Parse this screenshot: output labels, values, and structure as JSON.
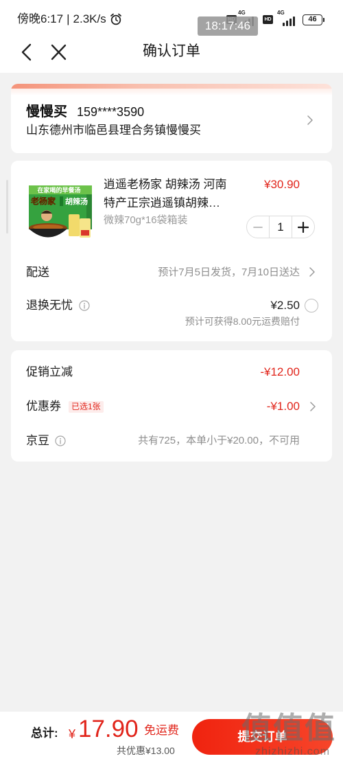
{
  "status_bar": {
    "time": "傍晚6:17",
    "separator": "|",
    "net_speed": "2.3K/s",
    "sim1_hd": "HD",
    "sim1_net": "4G",
    "sim2_hd": "HD",
    "sim2_net": "4G",
    "battery": "46",
    "icons": [
      "alarm-icon",
      "signal-icon",
      "battery-icon"
    ]
  },
  "recording_time": "18:17:46",
  "header": {
    "title": "确认订单",
    "icons": [
      "back-icon",
      "close-icon"
    ]
  },
  "address": {
    "name": "慢慢买",
    "phone": "159****3590",
    "detail": "山东德州市临邑县理合务镇慢慢买",
    "icon": "chevron-right-icon"
  },
  "product": {
    "title_lines": [
      "逍遥老杨家 胡辣汤 河南",
      "特产正宗逍遥镇胡辣…"
    ],
    "price": "¥30.90",
    "spec": "微辣70g*16袋箱装",
    "quantity": "1",
    "stepper_icons": [
      "minus-icon",
      "plus-icon"
    ],
    "image_text": {
      "banner": "在家喝的早餐汤",
      "brand": "老杨家",
      "name": "胡辣汤"
    }
  },
  "delivery": {
    "label": "配送",
    "value": "预计7月5日发货，7月10日送达"
  },
  "return_insurance": {
    "label": "退换无忧",
    "price": "¥2.50",
    "note": "预计可获得8.00元运费赔付",
    "selected": false
  },
  "discounts": {
    "promotion": {
      "label": "促销立减",
      "value": "-¥12.00"
    },
    "coupon": {
      "label": "优惠券",
      "badge": "已选1张",
      "value": "-¥1.00"
    },
    "jingdou": {
      "label": "京豆",
      "value": "共有725，本单小于¥20.00，不可用"
    }
  },
  "footer": {
    "total_label": "总计:",
    "currency": "¥",
    "total": "17.90",
    "shipping": "免运费",
    "saved": "共优惠¥13.00",
    "submit_label": "提交订单"
  },
  "watermark": {
    "logo": "值值值",
    "site": "zhizhizhi.com"
  },
  "colors": {
    "accent": "#e1251b",
    "background": "#f2f2f2",
    "muted_text": "#8e8e8e"
  }
}
